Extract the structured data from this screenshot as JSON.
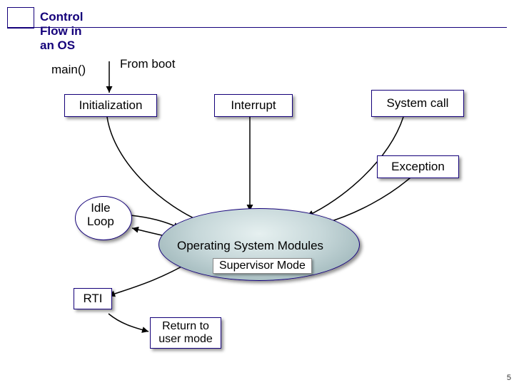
{
  "title": "Control Flow in an OS",
  "labels": {
    "main": "main()",
    "from_boot": "From boot",
    "os_modules": "Operating System Modules",
    "supervisor": "Supervisor Mode",
    "return_user": "Return to\nuser mode"
  },
  "nodes": {
    "initialization": "Initialization",
    "interrupt": "Interrupt",
    "system_call": "System call",
    "exception": "Exception",
    "idle_loop": "Idle\nLoop",
    "rti": "RTI"
  },
  "page_number": "5",
  "colors": {
    "accent": "#14007a"
  }
}
